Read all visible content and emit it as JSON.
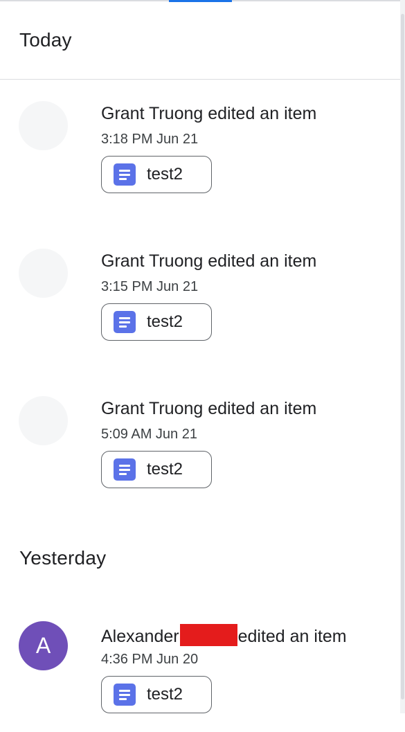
{
  "colors": {
    "accent": "#1a73e8",
    "doc_icon": "#5b72e8",
    "avatar_purple": "#6f4fb8",
    "redaction": "#e41c1c"
  },
  "sections": [
    {
      "label": "Today",
      "entries": [
        {
          "headline": "Grant Truong edited an item",
          "time": "3:18 PM Jun 21",
          "file": {
            "name": "test2",
            "icon": "google-docs-icon"
          }
        },
        {
          "headline": "Grant Truong edited an item",
          "time": "3:15 PM Jun 21",
          "file": {
            "name": "test2",
            "icon": "google-docs-icon"
          }
        },
        {
          "headline": "Grant Truong edited an item",
          "time": "5:09 AM Jun 21",
          "file": {
            "name": "test2",
            "icon": "google-docs-icon"
          }
        }
      ]
    },
    {
      "label": "Yesterday",
      "entries": [
        {
          "avatar_letter": "A",
          "actor": "Alexander",
          "action": "edited an item",
          "time": "4:36 PM Jun 20",
          "file": {
            "name": "test2",
            "icon": "google-docs-icon"
          }
        }
      ]
    }
  ]
}
